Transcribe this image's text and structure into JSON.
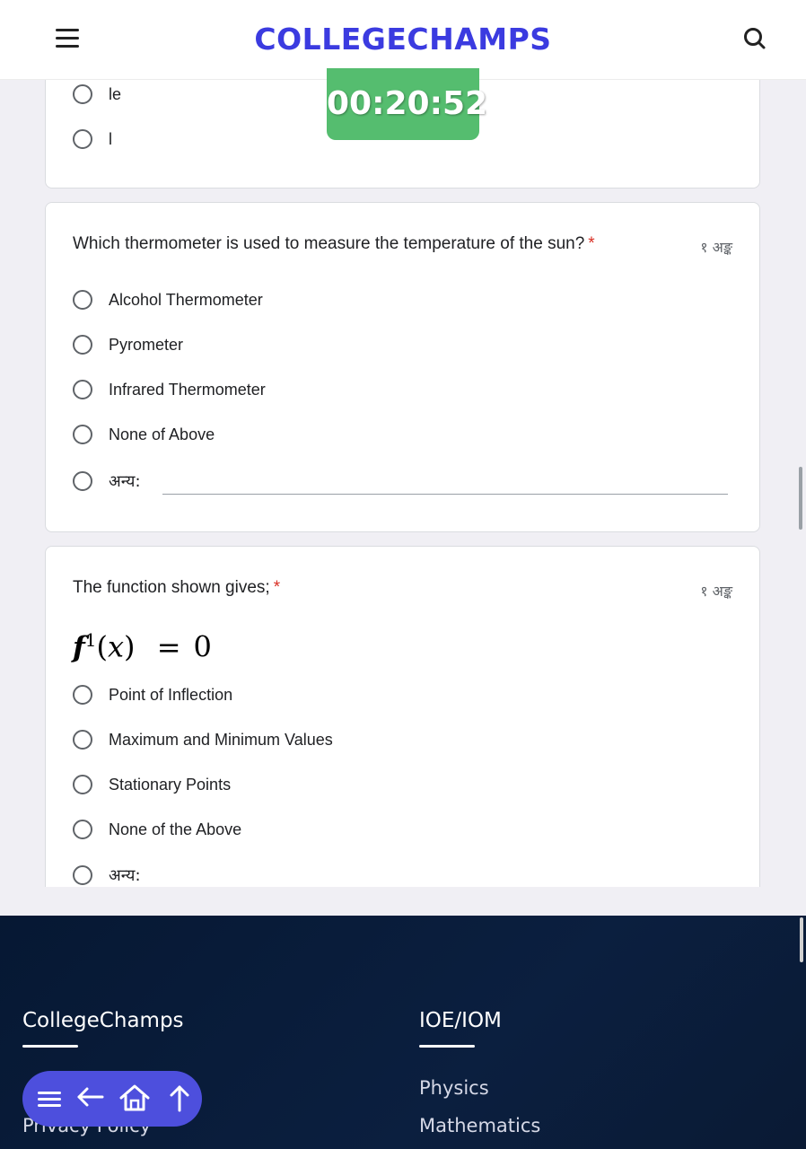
{
  "header": {
    "brand": "COLLEGECHAMPS",
    "menu_icon": "hamburger-menu-icon",
    "search_icon": "search-icon"
  },
  "timer": "00:20:52",
  "prev_card": {
    "options": [
      "le",
      "l"
    ]
  },
  "question1": {
    "title": "Which thermometer is used to measure the temperature of the sun?",
    "required_mark": "*",
    "marks": "१ अङ्क",
    "options": [
      "Alcohol Thermometer",
      "Pyrometer",
      "Infrared Thermometer",
      "None of Above"
    ],
    "other_label": "अन्य:",
    "other_value": ""
  },
  "question2": {
    "title": "The function shown gives;",
    "required_mark": "*",
    "marks": "१ अङ्क",
    "formula": {
      "f": "f",
      "sup": "1",
      "lparen": "(",
      "x": "x",
      "rparen": ")",
      "eq": "=",
      "zero": "0"
    },
    "options": [
      "Point of Inflection",
      "Maximum and Minimum Values",
      "Stationary Points",
      "None of the Above"
    ],
    "other_label": "अन्य:"
  },
  "footer": {
    "col1": {
      "title": "CollegeChamps",
      "links": [
        "Privacy Policy"
      ]
    },
    "col2": {
      "title": "IOE/IOM",
      "links": [
        "Physics",
        "Mathematics"
      ]
    }
  },
  "float_nav": {
    "icons": [
      "menu-icon",
      "back-arrow-icon",
      "home-icon",
      "up-arrow-icon"
    ]
  },
  "colors": {
    "brand": "#3b3be0",
    "timer_bg": "#55bd6f",
    "required": "#d93025",
    "footer_bg": "#0b1f3f",
    "float_nav_bg": "#4d4fdd"
  }
}
